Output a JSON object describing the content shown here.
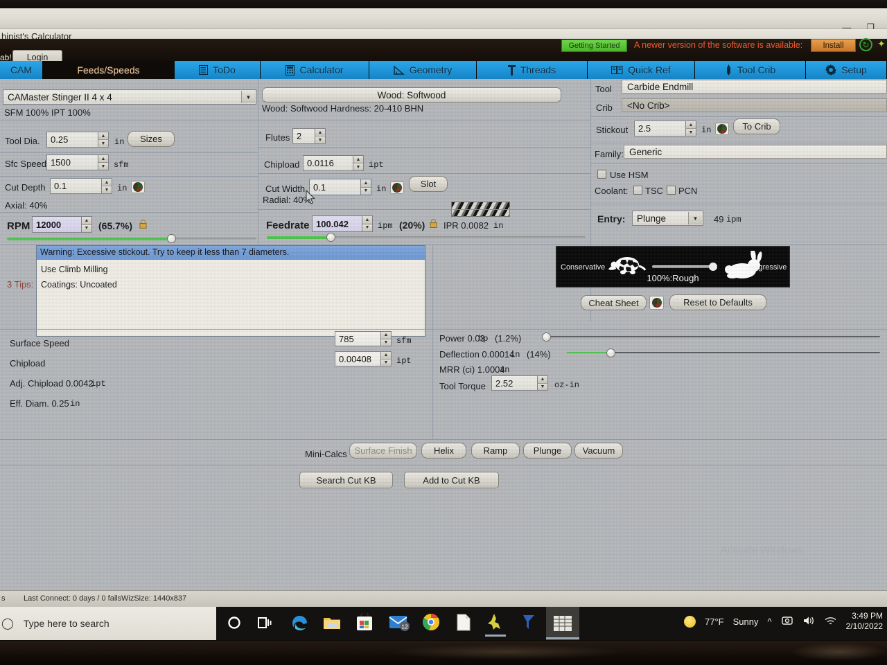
{
  "window": {
    "app_title": "hinist's Calculator",
    "minimize": "—",
    "restore": "❐"
  },
  "header": {
    "login_label": "Login",
    "ab_text": "ab!",
    "getting_started": "Getting Started",
    "update_message": "A newer version of the software is available:",
    "install_label": "Install",
    "accent_blue": "#1e94d8",
    "accent_orange": "#f0572e",
    "accent_green": "#4cb52c"
  },
  "tabs": [
    {
      "label": "CAM",
      "icon": "",
      "active": false
    },
    {
      "label": "Feeds/Speeds",
      "icon": "",
      "active": true
    },
    {
      "label": "ToDo",
      "icon": "list-icon",
      "active": false
    },
    {
      "label": "Calculator",
      "icon": "calculator-icon",
      "active": false
    },
    {
      "label": "Geometry",
      "icon": "triangle-icon",
      "active": false
    },
    {
      "label": "Threads",
      "icon": "thread-icon",
      "active": false
    },
    {
      "label": "Quick Ref",
      "icon": "book-icon",
      "active": false
    },
    {
      "label": "Tool Crib",
      "icon": "endmill-icon",
      "active": false
    },
    {
      "label": "Setup",
      "icon": "gear-icon",
      "active": false
    }
  ],
  "machine": {
    "name": "CAMaster Stinger II 4 x 4",
    "percents": "SFM 100%  IPT 100%"
  },
  "left_panel": {
    "tool_dia_label": "Tool Dia.",
    "tool_dia_value": "0.25",
    "tool_dia_unit": "in",
    "sizes_button": "Sizes",
    "sfc_speed_label": "Sfc Speed",
    "sfc_speed_value": "1500",
    "sfc_speed_unit": "sfm",
    "cut_depth_label": "Cut Depth",
    "cut_depth_value": "0.1",
    "cut_depth_unit": "in",
    "axial_label": "Axial: 40%",
    "rpm_label": "RPM",
    "rpm_value": "12000",
    "rpm_percent": "(65.7%)"
  },
  "center_panel": {
    "material_bar": "Wood: Softwood",
    "hardness": "Wood: Softwood Hardness: 20-410 BHN",
    "flutes_label": "Flutes",
    "flutes_value": "2",
    "chipload_label": "Chipload",
    "chipload_value": "0.0116",
    "chipload_unit": "ipt",
    "cut_width_label": "Cut Width",
    "cut_width_value": "0.1",
    "cut_width_unit": "in",
    "slot_button": "Slot",
    "radial_label": "Radial: 40%",
    "feedrate_label": "Feedrate",
    "feedrate_value": "100.042",
    "feedrate_unit": "ipm",
    "feedrate_percent": "(20%)",
    "ipr_text": "IPR 0.0082",
    "ipr_unit": "in"
  },
  "right_panel": {
    "tool_label": "Tool",
    "tool_value": "Carbide Endmill",
    "crib_label": "Crib",
    "crib_value": "<No Crib>",
    "stickout_label": "Stickout",
    "stickout_value": "2.5",
    "stickout_unit": "in",
    "to_crib_button": "To Crib",
    "family_label": "Family:",
    "family_value": "Generic",
    "use_hsm_label": "Use HSM",
    "coolant_label": "Coolant:",
    "coolant_tsc": "TSC",
    "coolant_pcn": "PCN",
    "entry_label": "Entry:",
    "entry_value": "Plunge",
    "entry_rate": "49",
    "entry_unit": "ipm"
  },
  "tips": {
    "label": "3 Tips:",
    "warning": "Warning: Excessive stickout. Try to keep it less than 7 diameters.",
    "items": [
      "Use Climb Milling",
      "Coatings: Uncoated"
    ]
  },
  "aggression": {
    "conservative": "Conservative",
    "aggressive": "Aggressive",
    "percent_text": "100%:Rough",
    "cheat_sheet_button": "Cheat Sheet",
    "reset_button": "Reset to Defaults"
  },
  "results": {
    "surface_speed_label": "Surface Speed",
    "surface_speed_value": "785",
    "surface_speed_unit": "sfm",
    "chipload_label": "Chipload",
    "chipload_value": "0.00408",
    "chipload_unit": "ipt",
    "adj_chipload": "Adj. Chipload 0.0042",
    "adj_chipload_unit": "ipt",
    "eff_diam": "Eff. Diam. 0.25",
    "eff_diam_unit": "in",
    "power": "Power 0.03",
    "power_unit": "hp",
    "power_percent": "(1.2%)",
    "deflection": "Deflection 0.00014",
    "deflection_unit": "in",
    "deflection_percent": "(14%)",
    "mrr": "MRR (ci) 1.0004",
    "mrr_unit": "in",
    "tool_torque_label": "Tool Torque",
    "tool_torque_value": "2.52",
    "tool_torque_unit": "oz-in"
  },
  "minicalcs": {
    "label": "Mini-Calcs",
    "buttons": [
      "Surface Finish",
      "Helix",
      "Ramp",
      "Plunge",
      "Vacuum"
    ]
  },
  "kb": {
    "search_button": "Search Cut KB",
    "add_button": "Add to Cut KB"
  },
  "watermark": "Activate Windows",
  "statusbar": {
    "left_fragment": "s",
    "last_connect": "Last Connect: 0 days / 0 fails",
    "wiz_size": "WizSize: 1440x837"
  },
  "taskbar": {
    "search_placeholder": "Type here to search",
    "mail_badge": "12",
    "weather_temp": "77°F",
    "weather_desc": "Sunny",
    "time": "3:49 PM",
    "date": "2/10/2022"
  },
  "charts": {
    "rpm_slider_pct": 65.7,
    "feed_slider_pct": 20,
    "power_slider_pct": 1.2,
    "deflection_slider_pct": 14,
    "aggression_pct": 100
  }
}
